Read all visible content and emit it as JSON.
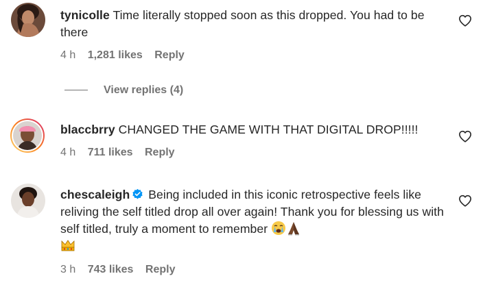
{
  "comments": [
    {
      "username": "tynicolle",
      "text": "Time literally stopped soon as this dropped. You had to be there",
      "time": "4 h",
      "likes": "1,281 likes",
      "reply_label": "Reply",
      "view_replies_label": "View replies (4)"
    },
    {
      "username": "blaccbrry",
      "text": "CHANGED THE GAME WITH THAT DIGITAL DROP!!!!!",
      "time": "4 h",
      "likes": "711 likes",
      "reply_label": "Reply"
    },
    {
      "username": "chescaleigh",
      "verified": true,
      "text": "Being included in this iconic retrospective feels like reliving the self titled drop all over again! Thank you for blessing us with self titled, truly a moment to remember",
      "emojis": [
        "crying-face",
        "folded-hands",
        "crown"
      ],
      "time": "3 h",
      "likes": "743 likes",
      "reply_label": "Reply"
    }
  ],
  "icons": {
    "like": "heart-outline-icon",
    "verified": "verified-badge-icon"
  },
  "colors": {
    "text": "#262626",
    "secondary": "#737373",
    "verified": "#0095f6",
    "story_ring_start": "#feda75",
    "story_ring_end": "#d62976"
  }
}
